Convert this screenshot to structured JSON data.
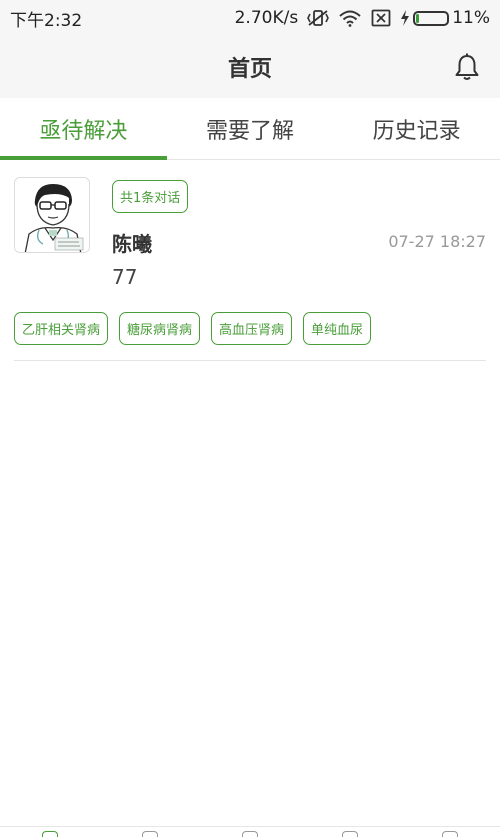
{
  "status_bar": {
    "time": "下午2:32",
    "network_speed": "2.70K/s",
    "battery_percent": "11%",
    "battery_level": 0.11,
    "icons": [
      "vibrate-off-icon",
      "wifi-icon",
      "no-sim-icon",
      "charging-icon",
      "battery-icon"
    ]
  },
  "header": {
    "title": "首页",
    "bell_icon": "bell-icon"
  },
  "tabs": [
    {
      "label": "亟待解决",
      "active": true
    },
    {
      "label": "需要了解",
      "active": false
    },
    {
      "label": "历史记录",
      "active": false
    }
  ],
  "conversation": {
    "badge": "共1条对话",
    "name": "陈曦",
    "time": "07-27 18:27",
    "message": "77",
    "tags": [
      "乙肝相关肾病",
      "糖尿病肾病",
      "高血压肾病",
      "单纯血尿"
    ]
  },
  "colors": {
    "accent": "#4a9e3a",
    "header_bg": "#f6f6f6",
    "muted_text": "#999999"
  },
  "bottom_nav": {
    "icons": [
      "home-icon",
      "document-icon",
      "community-icon",
      "calendar-icon",
      "profile-icon"
    ]
  }
}
